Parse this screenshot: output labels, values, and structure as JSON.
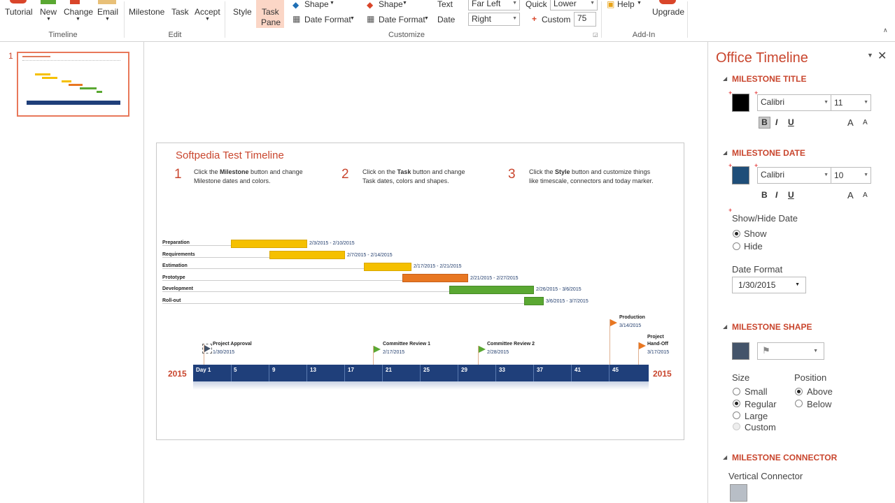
{
  "ribbon": {
    "timeline_group": {
      "label": "Timeline",
      "tutorial": "Tutorial",
      "new": "New",
      "change": "Change",
      "email": "Email"
    },
    "edit_group": {
      "label": "Edit",
      "milestone": "Milestone",
      "task": "Task",
      "accept": "Accept"
    },
    "customize_group": {
      "label": "Customize",
      "style": "Style",
      "task_pane": "Task",
      "task_pane2": "Pane",
      "shape1": "Shape",
      "date_format1": "Date Format",
      "shape2": "Shape",
      "date_format2": "Date Format",
      "text": "Text",
      "date": "Date",
      "far_left": "Far Left",
      "right": "Right",
      "quick": "Quick",
      "lower": "Lower",
      "custom": "Custom",
      "custom_value": "75"
    },
    "addin_group": {
      "label": "Add-In",
      "help": "Help",
      "upgrade": "Upgrade"
    }
  },
  "thumbnail": {
    "number": "1"
  },
  "slide": {
    "title": "Softpedia Test Timeline",
    "steps": [
      {
        "num": "1",
        "pre": "Click the ",
        "bold": "Milestone",
        "post": " button and change",
        "line2": "Milestone dates and colors."
      },
      {
        "num": "2",
        "pre": "Click on the ",
        "bold": "Task",
        "post": " button and change",
        "line2": "Task dates, colors and shapes."
      },
      {
        "num": "3",
        "pre": "Click the ",
        "bold": "Style",
        "post": " button and customize things",
        "line2": "like timescale, connectors and today marker."
      }
    ],
    "tasks": [
      {
        "name": "Preparation",
        "dates": "2/3/2015 - 2/10/2015",
        "color": "#f5c000"
      },
      {
        "name": "Requirements",
        "dates": "2/7/2015 - 2/14/2015",
        "color": "#f5c000"
      },
      {
        "name": "Estimation",
        "dates": "2/17/2015 - 2/21/2015",
        "color": "#f5c000"
      },
      {
        "name": "Prototype",
        "dates": "2/21/2015 - 2/27/2015",
        "color": "#e87722"
      },
      {
        "name": "Development",
        "dates": "2/26/2015 - 3/6/2015",
        "color": "#5aa832"
      },
      {
        "name": "Roll-out",
        "dates": "3/6/2015 - 3/7/2015",
        "color": "#5aa832"
      }
    ],
    "milestones": [
      {
        "name": "Project Approval",
        "date": "1/30/2015"
      },
      {
        "name": "Committee Review 1",
        "date": "2/17/2015"
      },
      {
        "name": "Committee Review 2",
        "date": "2/28/2015"
      },
      {
        "name": "Production",
        "date": "3/14/2015"
      },
      {
        "name": "Project",
        "name2": "Hand-Off",
        "date": "3/17/2015"
      }
    ],
    "year_left": "2015",
    "year_right": "2015",
    "ticks": [
      "Day 1",
      "5",
      "9",
      "13",
      "17",
      "21",
      "25",
      "29",
      "33",
      "37",
      "41",
      "45"
    ]
  },
  "pane": {
    "title": "Office Timeline",
    "milestone_title": "MILESTONE TITLE",
    "font1": "Calibri",
    "size1": "11",
    "bold": "B",
    "italic": "I",
    "underline": "U",
    "grow": "A",
    "shrink": "A",
    "milestone_date": "MILESTONE DATE",
    "font2": "Calibri",
    "size2": "10",
    "show_hide": "Show/Hide Date",
    "show": "Show",
    "hide": "Hide",
    "date_format_label": "Date Format",
    "date_format_value": "1/30/2015",
    "milestone_shape": "MILESTONE SHAPE",
    "size_label": "Size",
    "small": "Small",
    "regular": "Regular",
    "large": "Large",
    "custom": "Custom",
    "position_label": "Position",
    "above": "Above",
    "below": "Below",
    "milestone_connector": "MILESTONE CONNECTOR",
    "vertical_connector": "Vertical Connector",
    "colors": {
      "title_swatch": "#000000",
      "date_swatch": "#1f4e79",
      "shape_swatch": "#44546a",
      "connector_swatch": "#b8bec6",
      "accent": "#c9462e"
    }
  }
}
